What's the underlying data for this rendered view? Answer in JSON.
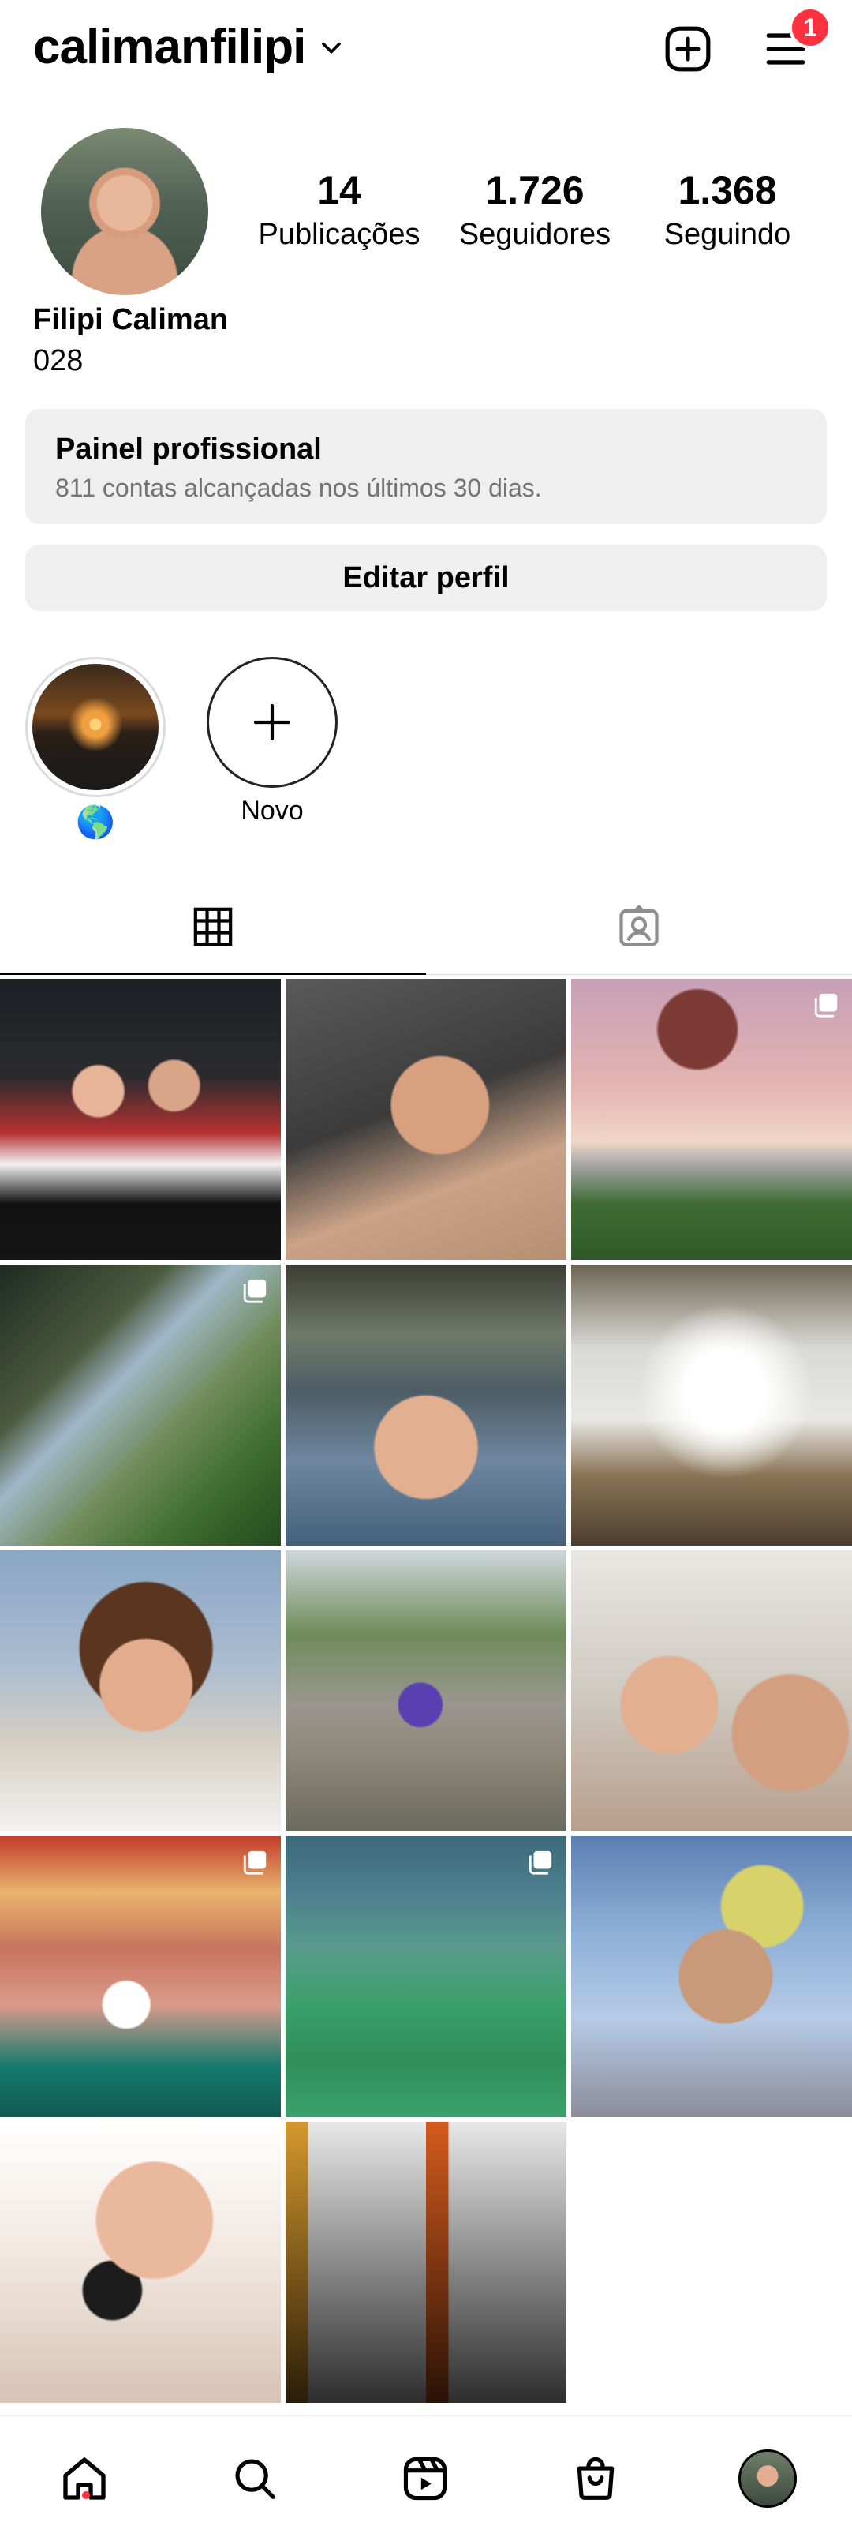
{
  "header": {
    "username": "calimanfilipi",
    "notification_count": "1"
  },
  "profile": {
    "stats": [
      {
        "value": "14",
        "label": "Publicações"
      },
      {
        "value": "1.726",
        "label": "Seguidores"
      },
      {
        "value": "1.368",
        "label": "Seguindo"
      }
    ],
    "full_name": "Filipi Caliman",
    "bio": "028"
  },
  "dashboard": {
    "title": "Painel profissional",
    "subtitle": "811 contas alcançadas nos últimos 30 dias."
  },
  "edit_button": "Editar perfil",
  "highlights": [
    {
      "label": "🌎"
    },
    {
      "label": "Novo"
    }
  ],
  "tabs": [
    {
      "icon": "grid-icon",
      "active": true
    },
    {
      "icon": "tagged-icon",
      "active": false
    }
  ],
  "grid": {
    "posts": [
      {
        "name": "post-party-friends",
        "multi": false
      },
      {
        "name": "post-selfie-car",
        "multi": false
      },
      {
        "name": "post-tree-sunset",
        "multi": true
      },
      {
        "name": "post-tent-view",
        "multi": true
      },
      {
        "name": "post-waterfall-selfie",
        "multi": false
      },
      {
        "name": "post-waterfall-swim",
        "multi": false
      },
      {
        "name": "post-selfie-curly",
        "multi": false
      },
      {
        "name": "post-park-trophy",
        "multi": false
      },
      {
        "name": "post-selfie-mother",
        "multi": false
      },
      {
        "name": "post-birthday-cake",
        "multi": true
      },
      {
        "name": "post-futsal-court",
        "multi": true
      },
      {
        "name": "post-selfie-cap",
        "multi": false
      },
      {
        "name": "post-kiss-sunglasses",
        "multi": false
      },
      {
        "name": "post-futsal-game",
        "multi": false
      }
    ]
  },
  "nav": {
    "items": [
      "home-icon",
      "search-icon",
      "reels-icon",
      "shop-icon",
      "profile-avatar"
    ]
  }
}
